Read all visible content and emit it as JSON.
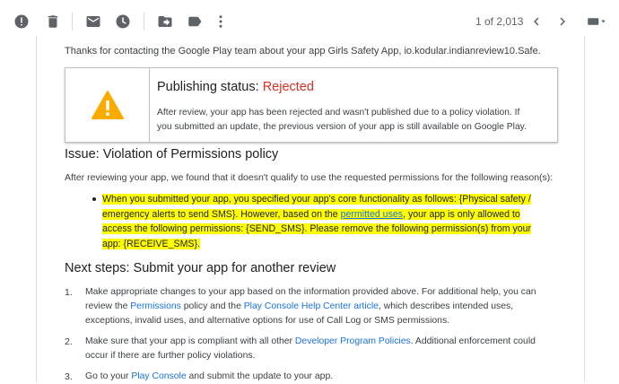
{
  "toolbar": {
    "icons": [
      "report-spam-icon",
      "delete-icon",
      "mark-unread-icon",
      "snooze-icon",
      "move-to-icon",
      "label-icon",
      "more-icon",
      "prev-icon",
      "next-icon",
      "input-tools-icon"
    ],
    "page_count": "1 of 2,013"
  },
  "email": {
    "intro": "Thanks for contacting the Google Play team about your app Girls Safety App, io.kodular.indianreview10.Safe.",
    "status": {
      "title_prefix": "Publishing status: ",
      "title_value": "Rejected",
      "text": "After review, your app has been rejected and wasn't published due to a policy violation. If you submitted an update, the previous version of your app is still available on Google Play."
    },
    "issue_heading": "Issue: Violation of Permissions policy",
    "issue_intro": "After reviewing your app, we found that it doesn't qualify to use the requested permissions for the following reason(s):",
    "highlight": {
      "part1": "When you submitted your app, you specified your app's core functionality as follows: {Physical safety / emergency alerts to send SMS}. However, based on the ",
      "link": "permitted uses",
      "part2": ", your app is only allowed to access the following permissions: {SEND_SMS}. Please remove the following permission(s) from your app: {RECEIVE_SMS}."
    },
    "next_heading": "Next steps: Submit your app for another review",
    "steps": [
      {
        "num": "1.",
        "a": "Make appropriate changes to your app based on the information provided above. For additional help, you can review the ",
        "link1": "Permissions",
        "b": " policy and the ",
        "link2": "Play Console Help Center article",
        "c": ", which describes intended uses, exceptions, invalid uses, and alternative options for use of Call Log or SMS permissions."
      },
      {
        "num": "2.",
        "a": "Make sure that your app is compliant with all other ",
        "link1": "Developer Program Policies",
        "b": ". Additional enforcement could occur if there are further policy violations."
      },
      {
        "num": "3.",
        "a": "Go to your ",
        "link1": "Play Console",
        "b": " and submit the update to your app."
      }
    ]
  },
  "colors": {
    "rejected": "#d93025",
    "link": "#1a73e8",
    "highlight": "#ffff00",
    "warning": "#f9ab00"
  }
}
